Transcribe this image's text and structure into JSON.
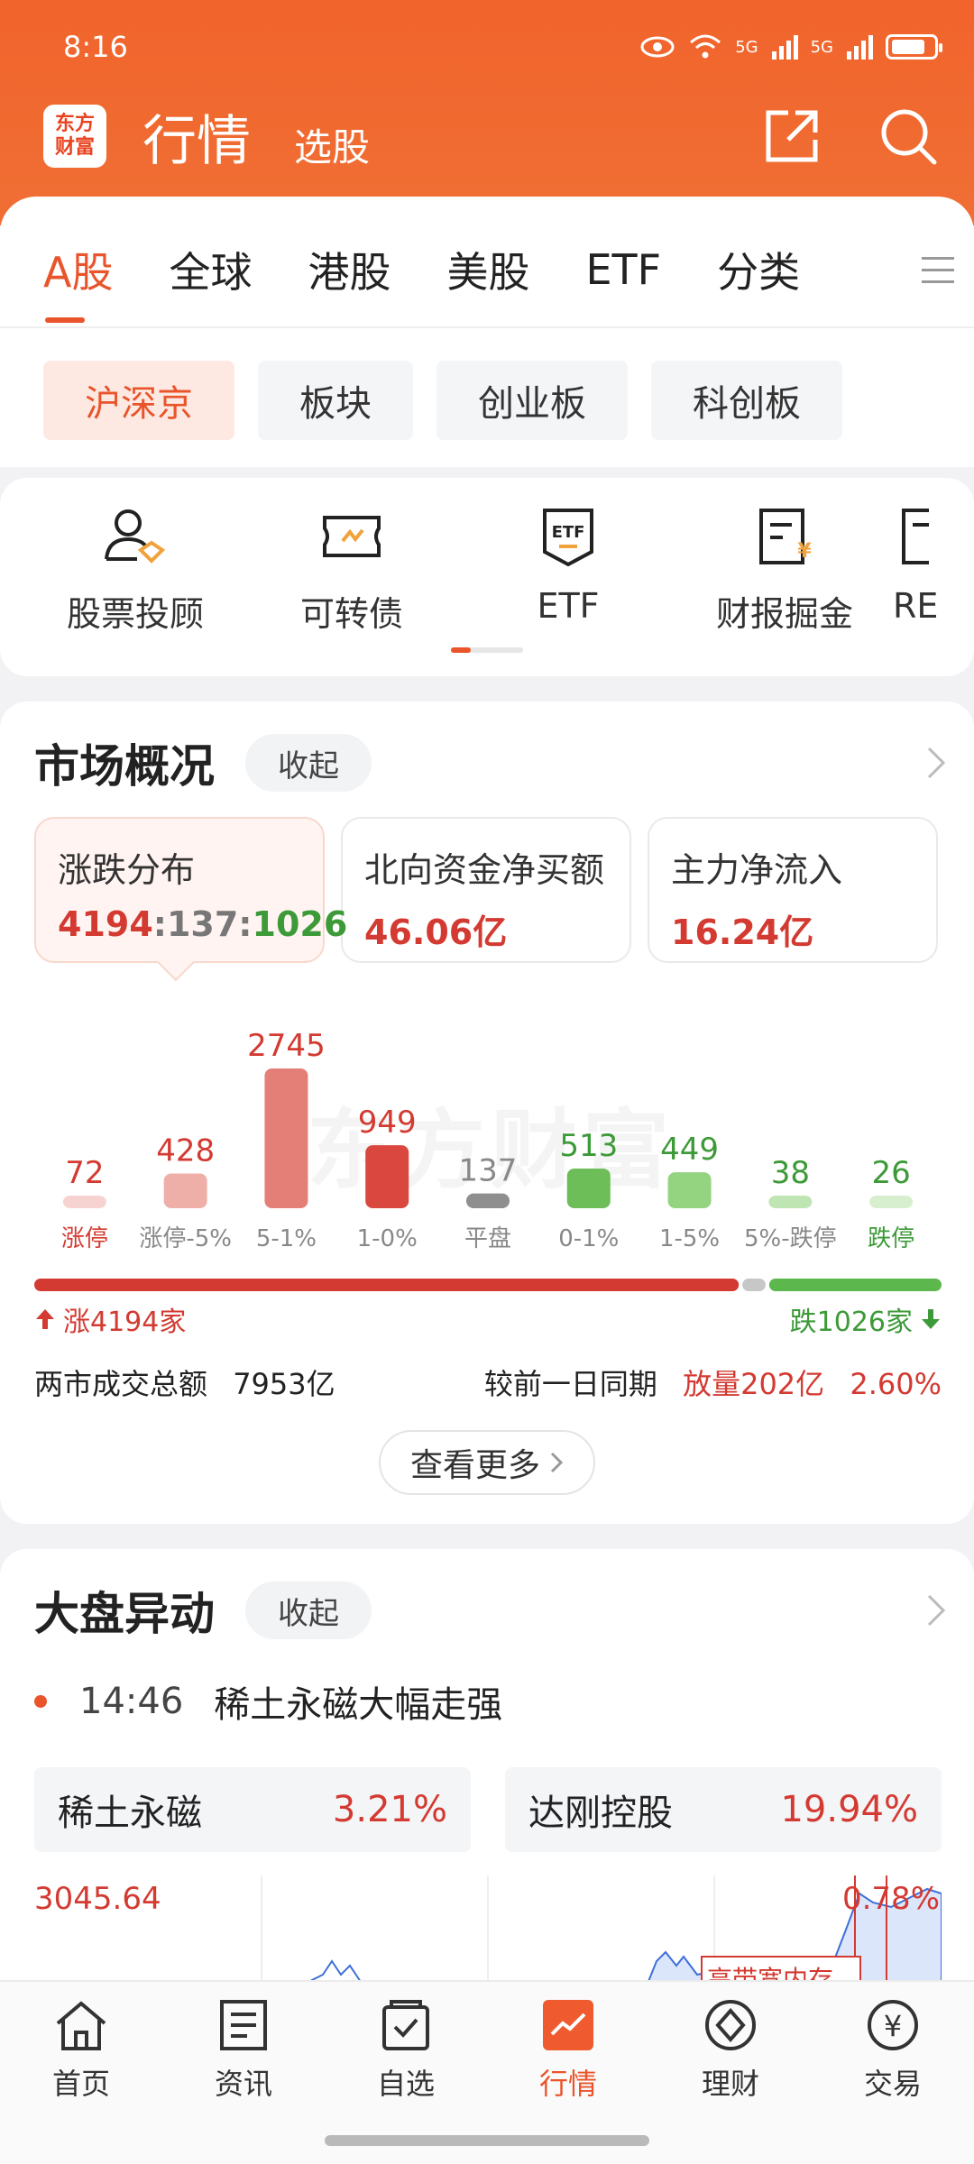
{
  "status": {
    "time": "8:16",
    "net1": "5G",
    "net2": "5G"
  },
  "header": {
    "logo_line1": "东方",
    "logo_line2": "财富",
    "title": "行情",
    "subtitle": "选股"
  },
  "tabs": [
    "A股",
    "全球",
    "港股",
    "美股",
    "ETF",
    "分类"
  ],
  "chips": [
    "沪深京",
    "板块",
    "创业板",
    "科创板"
  ],
  "tools": [
    {
      "label": "股票投顾",
      "icon": "advisor-icon"
    },
    {
      "label": "可转债",
      "icon": "bond-icon"
    },
    {
      "label": "ETF",
      "icon": "etf-icon"
    },
    {
      "label": "财报掘金",
      "icon": "report-icon"
    },
    {
      "label": "RE",
      "icon": "report-icon"
    }
  ],
  "market": {
    "title": "市场概况",
    "collapse": "收起",
    "boxes": [
      {
        "label": "涨跌分布",
        "up": "4194",
        "flat": "137",
        "down": "1026",
        "sep": ":"
      },
      {
        "label": "北向资金净买额",
        "value": "46.06亿"
      },
      {
        "label": "主力净流入",
        "value": "16.24亿"
      }
    ],
    "watermark": "东方财富",
    "breadth_up": "涨4194家",
    "breadth_down": "跌1026家",
    "turnover_label": "两市成交总额",
    "turnover_value": "7953亿",
    "compare_label": "较前一日同期",
    "compare_value": "放量202亿",
    "compare_pct": "2.60%",
    "more": "查看更多"
  },
  "chart_data": {
    "type": "bar",
    "categories": [
      "涨停",
      "涨停-5%",
      "5-1%",
      "1-0%",
      "平盘",
      "0-1%",
      "1-5%",
      "5%-跌停",
      "跌停"
    ],
    "values": [
      72,
      428,
      2745,
      949,
      137,
      513,
      449,
      38,
      26
    ],
    "colors": [
      "#f6d3d0",
      "#efafa9",
      "#e47f78",
      "#d9473f",
      "#8f8f8f",
      "#6dbd58",
      "#94d37f",
      "#bfe5b2",
      "#d8efcf"
    ],
    "label_colors": [
      "#d33a31",
      "#d33a31",
      "#d33a31",
      "#d33a31",
      "#888888",
      "#3d9a38",
      "#3d9a38",
      "#3d9a38",
      "#3d9a38"
    ],
    "category_label_colors": [
      "#d33a31",
      "#888888",
      "#888888",
      "#888888",
      "#888888",
      "#888888",
      "#888888",
      "#888888",
      "#3d9a38"
    ],
    "breadth": {
      "up": 4194,
      "flat": 137,
      "down": 1026
    }
  },
  "movement": {
    "title": "大盘异动",
    "collapse": "收起",
    "event_time": "14:46",
    "event_text": "稀土永磁大幅走强",
    "tiles": [
      {
        "name": "稀土永磁",
        "pct": "3.21%"
      },
      {
        "name": "达刚控股",
        "pct": "19.94%"
      }
    ],
    "index_value": "3045.64",
    "index_pct": "0.78%",
    "annotation": "高带宽内存"
  },
  "nav": [
    {
      "label": "首页",
      "icon": "home-icon"
    },
    {
      "label": "资讯",
      "icon": "news-icon"
    },
    {
      "label": "自选",
      "icon": "watchlist-icon"
    },
    {
      "label": "行情",
      "icon": "market-icon"
    },
    {
      "label": "理财",
      "icon": "wealth-icon"
    },
    {
      "label": "交易",
      "icon": "trade-icon"
    }
  ],
  "colors": {
    "brand": "#f1642c",
    "up": "#d33a31",
    "down": "#3d9a38"
  }
}
